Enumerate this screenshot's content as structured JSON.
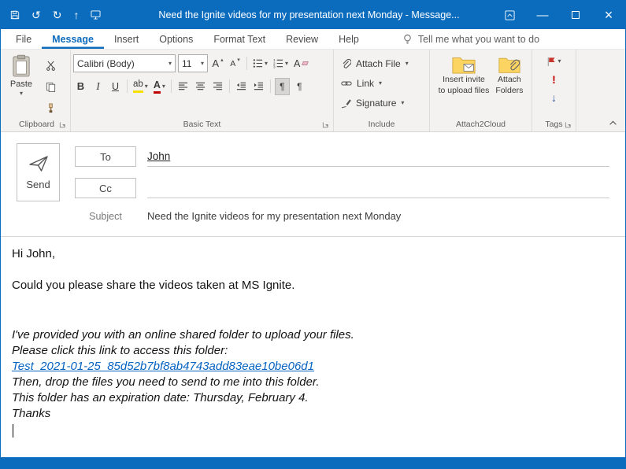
{
  "colors": {
    "titlebar_bg": "#0b6cbe",
    "accent": "#0f6cbd",
    "link": "#0563c1"
  },
  "titlebar": {
    "title": "Need the Ignite videos for my presentation next Monday  -  Message..."
  },
  "tabs": {
    "items": [
      "File",
      "Message",
      "Insert",
      "Options",
      "Format Text",
      "Review",
      "Help"
    ],
    "tell_me": "Tell me what you want to do"
  },
  "icons": {
    "undo": "↺",
    "redo": "↻",
    "up": "↑",
    "dropdown": "▾",
    "caret_up": "▴",
    "minimize": "—",
    "close": "×",
    "bold": "B",
    "italic": "I",
    "underline": "U",
    "highlight": "ab",
    "font_color": "A",
    "grow_font": "A",
    "shrink_font": "A",
    "clear_format": "A",
    "pilcrow": "¶",
    "high_importance": "!",
    "low_importance": "↓"
  },
  "ribbon": {
    "clipboard": {
      "label": "Clipboard",
      "paste": "Paste"
    },
    "basic_text": {
      "label": "Basic Text",
      "font_name": "Calibri (Body)",
      "font_size": "11"
    },
    "include": {
      "label": "Include",
      "attach_file": "Attach File",
      "link": "Link",
      "signature": "Signature"
    },
    "attach2cloud": {
      "label": "Attach2Cloud",
      "insert_invite_l1": "Insert invite",
      "insert_invite_l2": "to upload files",
      "attach_folders_l1": "Attach",
      "attach_folders_l2": "Folders"
    },
    "tags": {
      "label": "Tags"
    }
  },
  "compose": {
    "send": "Send",
    "to_button": "To",
    "cc_button": "Cc",
    "to_value": "John",
    "subject_label": "Subject",
    "subject_value": "Need the Ignite videos for my presentation next Monday"
  },
  "body": {
    "greeting": "Hi John,",
    "request": "Could you please share the videos taken at MS Ignite.",
    "shared_folder_intro": "I've provided you with an online shared folder to upload your files.",
    "click_link": "Please click this link to access this folder:",
    "folder_link": "Test_2021-01-25_85d52b7bf8ab4743add83eae10be06d1",
    "drop_files": "Then, drop the files you need to send to me into this folder.",
    "expiration": "This folder has an expiration date: Thursday, February 4.",
    "thanks": "Thanks"
  }
}
